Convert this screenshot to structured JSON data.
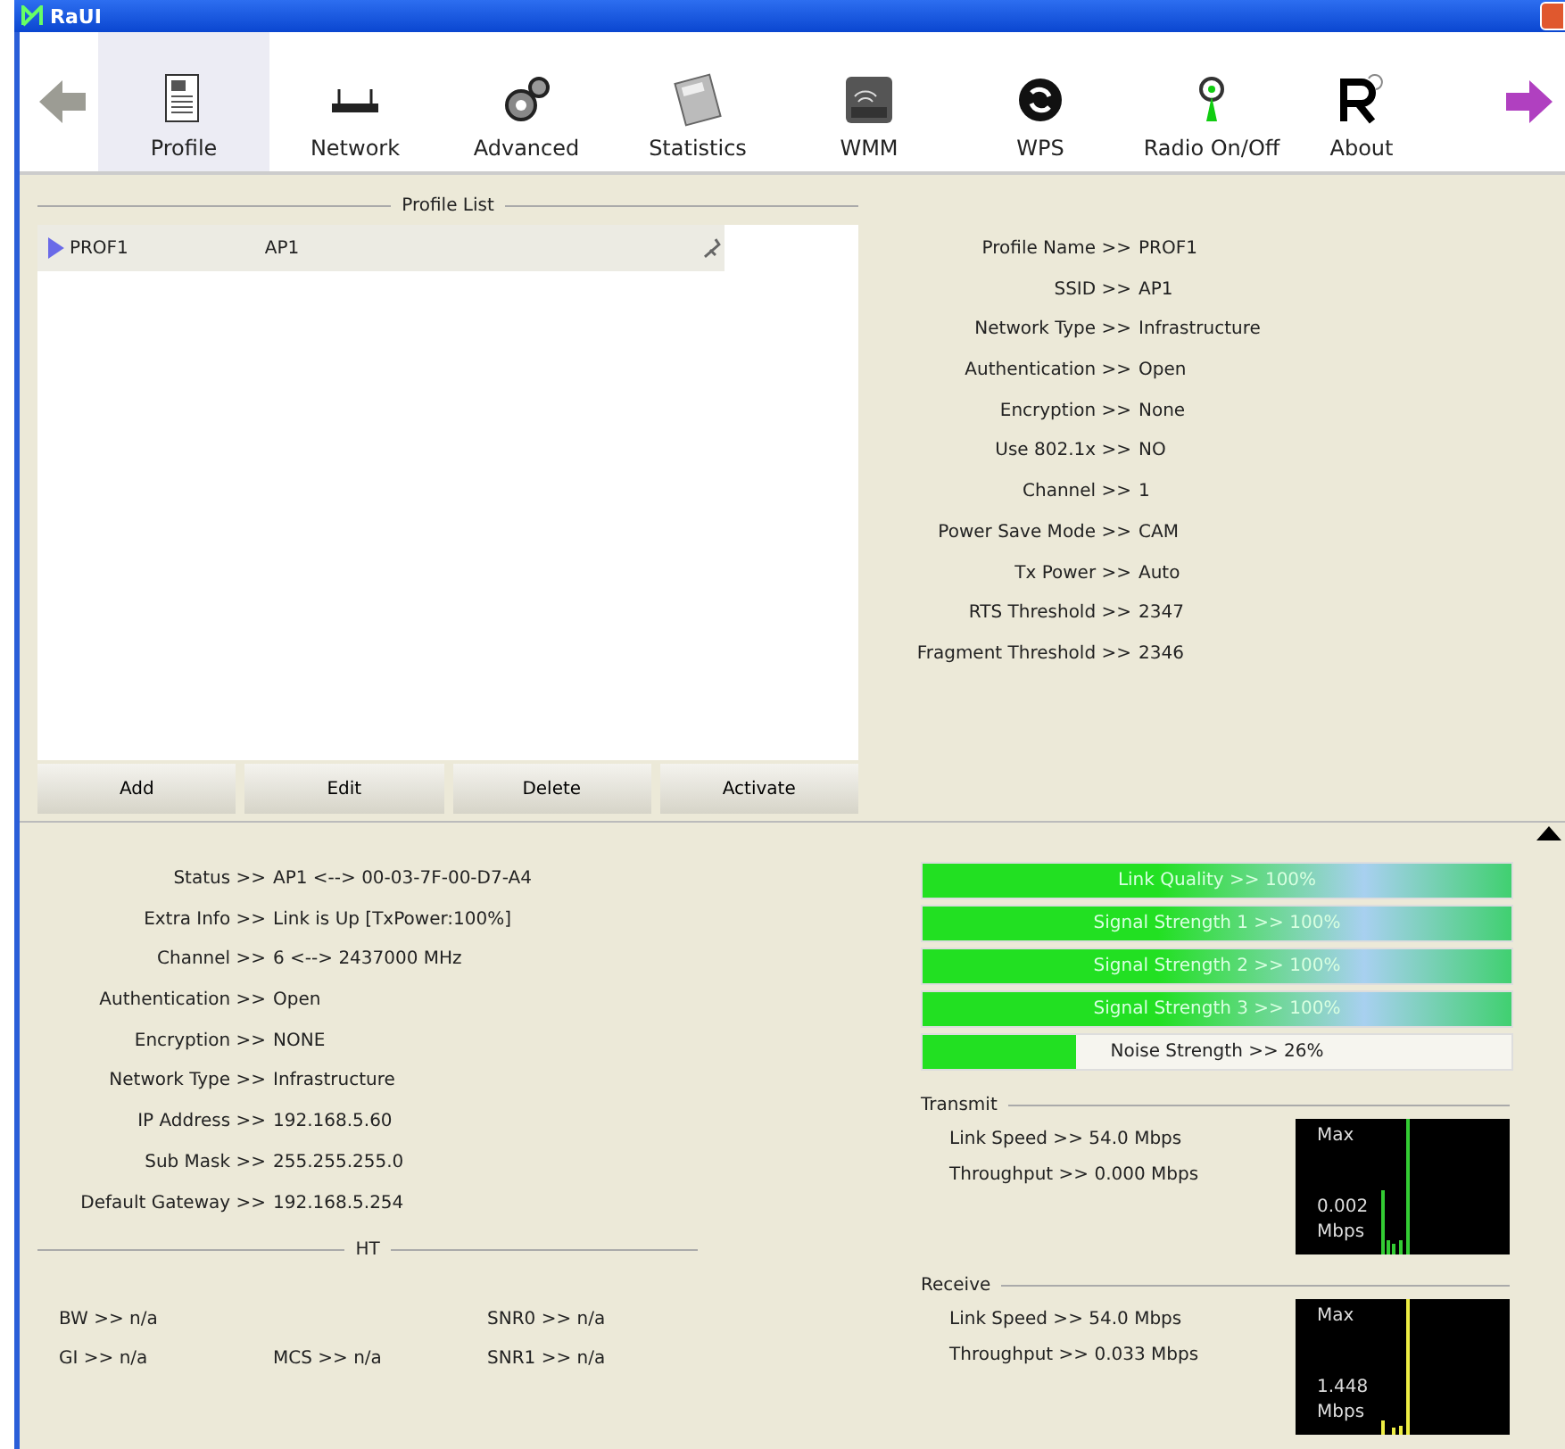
{
  "window": {
    "title": "RaUI"
  },
  "toolbar": [
    {
      "label": "Profile",
      "kind": "profile",
      "selected": true
    },
    {
      "label": "Network",
      "kind": "network",
      "selected": false
    },
    {
      "label": "Advanced",
      "kind": "advanced",
      "selected": false
    },
    {
      "label": "Statistics",
      "kind": "statistics",
      "selected": false
    },
    {
      "label": "WMM",
      "kind": "wmm",
      "selected": false
    },
    {
      "label": "WPS",
      "kind": "wps",
      "selected": false
    },
    {
      "label": "Radio On/Off",
      "kind": "radio",
      "selected": false
    },
    {
      "label": "About",
      "kind": "about",
      "selected": false
    }
  ],
  "profile_list": {
    "title": "Profile List",
    "rows": [
      {
        "name": "PROF1",
        "ssid": "AP1",
        "selected": true
      }
    ],
    "buttons": [
      "Add",
      "Edit",
      "Delete",
      "Activate"
    ]
  },
  "profile_details": [
    {
      "label": "Profile Name >>",
      "value": "PROF1"
    },
    {
      "label": "SSID >>",
      "value": "AP1"
    },
    {
      "label": "Network Type >>",
      "value": "Infrastructure"
    },
    {
      "label": "Authentication >>",
      "value": "Open"
    },
    {
      "label": "Encryption >>",
      "value": "None"
    },
    {
      "label": "Use 802.1x >>",
      "value": "NO"
    },
    {
      "label": "Channel >>",
      "value": "1"
    },
    {
      "label": "Power Save Mode >>",
      "value": "CAM"
    },
    {
      "label": "Tx Power >>",
      "value": "Auto"
    },
    {
      "label": "RTS Threshold >>",
      "value": "2347"
    },
    {
      "label": "Fragment Threshold >>",
      "value": "2346"
    }
  ],
  "status": [
    {
      "label": "Status >>",
      "value": "AP1 <--> 00-03-7F-00-D7-A4"
    },
    {
      "label": "Extra Info >>",
      "value": "Link is Up [TxPower:100%]"
    },
    {
      "label": "Channel >>",
      "value": "6 <--> 2437000 MHz"
    },
    {
      "label": "Authentication >>",
      "value": "Open"
    },
    {
      "label": "Encryption >>",
      "value": "NONE"
    },
    {
      "label": "Network Type >>",
      "value": "Infrastructure"
    },
    {
      "label": "IP Address >>",
      "value": "192.168.5.60"
    },
    {
      "label": "Sub Mask >>",
      "value": "255.255.255.0"
    },
    {
      "label": "Default Gateway >>",
      "value": "192.168.5.254"
    }
  ],
  "ht": {
    "title": "HT",
    "rows": [
      {
        "left": "BW >> n/a",
        "right": "SNR0 >> n/a"
      },
      {
        "left": "GI >> n/a",
        "middle": "MCS >> n/a",
        "right": "SNR1 >> n/a"
      }
    ]
  },
  "meters": [
    {
      "text": "Link Quality >> 100%",
      "level": 1
    },
    {
      "text": "Signal Strength 1 >> 100%",
      "level": 1
    },
    {
      "text": "Signal Strength 2 >> 100%",
      "level": 1
    },
    {
      "text": "Signal Strength 3 >> 100%",
      "level": 1
    },
    {
      "text": "Noise Strength >> 26%",
      "level": 0.26
    }
  ],
  "traffic": [
    {
      "title": "Transmit",
      "link_speed": "Link Speed >> 54.0 Mbps",
      "throughput": "Throughput >> 0.000 Mbps",
      "graph_max": "Max",
      "graph_value": "0.002",
      "graph_unit": "Mbps",
      "color": "#33cc33"
    },
    {
      "title": "Receive",
      "link_speed": "Link Speed >> 54.0 Mbps",
      "throughput": "Throughput >> 0.033 Mbps",
      "graph_max": "Max",
      "graph_value": "1.448",
      "graph_unit": "Mbps",
      "color": "#eeee44"
    }
  ]
}
